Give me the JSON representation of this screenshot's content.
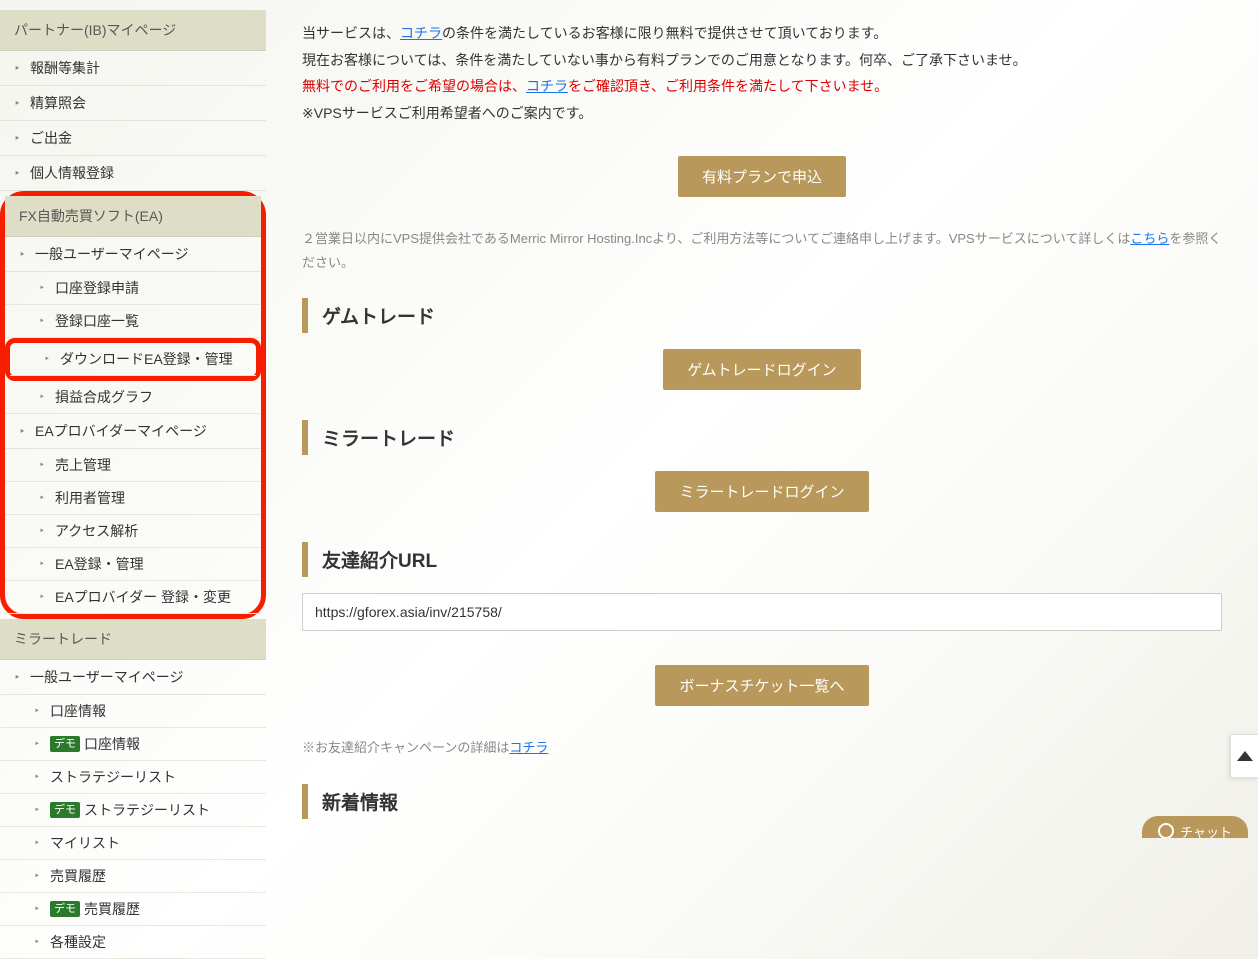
{
  "sidebar": {
    "group1": {
      "header": "パートナー(IB)マイページ",
      "items": [
        "報酬等集計",
        "精算照会",
        "ご出金",
        "個人情報登録"
      ]
    },
    "group2": {
      "header": "FX自動売買ソフト(EA)",
      "l1a": "一般ユーザーマイページ",
      "l2a": "口座登録申請",
      "l2b": "登録口座一覧",
      "l2c": "ダウンロードEA登録・管理",
      "l2d": "損益合成グラフ",
      "l1b": "EAプロバイダーマイページ",
      "l2e": "売上管理",
      "l2f": "利用者管理",
      "l2g": "アクセス解析",
      "l2h": "EA登録・管理",
      "l2i": "EAプロバイダー 登録・変更"
    },
    "group3": {
      "header": "ミラートレード",
      "l1a": "一般ユーザーマイページ",
      "l2a": "口座情報",
      "l2b": "口座情報",
      "l2c": "ストラテジーリスト",
      "l2d": "ストラテジーリスト",
      "l2e": "マイリスト",
      "l2f": "売買履歴",
      "l2g": "売買履歴",
      "l2h": "各種設定"
    },
    "demo_badge": "デモ"
  },
  "intro": {
    "l1a": "当サービスは、",
    "l1link": "コチラ",
    "l1b": "の条件を満たしているお客様に限り無料で提供させて頂いております。",
    "l2": "現在お客様については、条件を満たしていない事から有料プランでのご用意となります。何卒、ご了承下さいませ。",
    "l3a": "無料でのご利用をご希望の場合は、",
    "l3link": "コチラ",
    "l3b": "をご確認頂き、ご利用条件を満たして下さいませ。",
    "l4": "※VPSサービスご利用希望者へのご案内です。"
  },
  "buttons": {
    "paid_plan": "有料プランで申込",
    "gem_login": "ゲムトレードログイン",
    "mirror_login": "ミラートレードログイン",
    "bonus_list": "ボーナスチケット一覧へ"
  },
  "notes": {
    "vps_a": "２営業日以内にVPS提供会社であるMerric Mirror Hosting.Incより、ご利用方法等についてご連絡申し上げます。VPSサービスについて詳しくは",
    "vps_link": "こちら",
    "vps_b": "を参照ください。",
    "friend_a": "※お友達紹介キャンペーンの詳細は",
    "friend_link": "コチラ"
  },
  "sections": {
    "gem": "ゲムトレード",
    "mirror": "ミラートレード",
    "friend": "友達紹介URL",
    "news": "新着情報"
  },
  "friend_url": "https://gforex.asia/inv/215758/",
  "chat_label": "チャット"
}
